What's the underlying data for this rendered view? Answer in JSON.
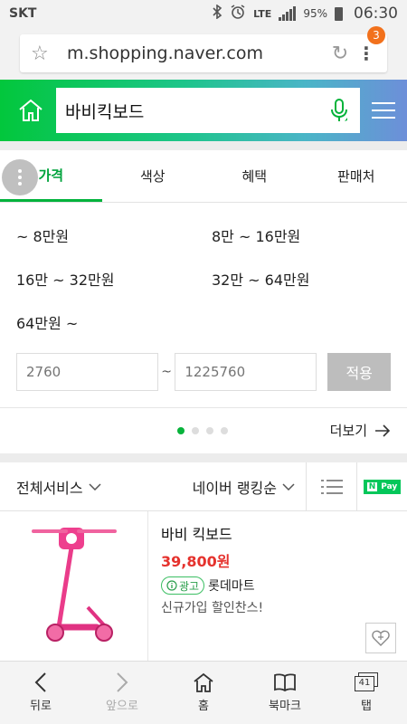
{
  "status_bar": {
    "carrier": "SKT",
    "network": "LTE",
    "battery": "95%",
    "time": "06:30"
  },
  "browser": {
    "url": "m.shopping.naver.com",
    "tab_badge": "3"
  },
  "search": {
    "query": "바비킥보드"
  },
  "tabs": [
    {
      "label": "가격",
      "active": true
    },
    {
      "label": "색상",
      "active": false
    },
    {
      "label": "혜택",
      "active": false
    },
    {
      "label": "판매처",
      "active": false
    }
  ],
  "price_filter": {
    "options": [
      "~ 8만원",
      "8만 ~ 16만원",
      "16만 ~ 32만원",
      "32만 ~ 64만원",
      "64만원 ~"
    ],
    "min_placeholder": "2760",
    "max_placeholder": "1225760",
    "tilde": "~",
    "apply_label": "적용"
  },
  "more_label": "더보기",
  "sort_bar": {
    "service_filter": "전체서비스",
    "ranking": "네이버 랭킹순",
    "npay_label": "Pay"
  },
  "product": {
    "name": "바비 킥보드",
    "price": "39,800원",
    "ad_label": "광고",
    "seller": "롯데마트",
    "promo": "신규가입 할인찬스!"
  },
  "bottom_nav": {
    "back": "뒤로",
    "forward": "앞으로",
    "home": "홈",
    "bookmarks": "북마크",
    "tabs": "탭",
    "tab_count": "41"
  },
  "colors": {
    "accent_green": "#02c73c",
    "price_red": "#e5322d"
  }
}
